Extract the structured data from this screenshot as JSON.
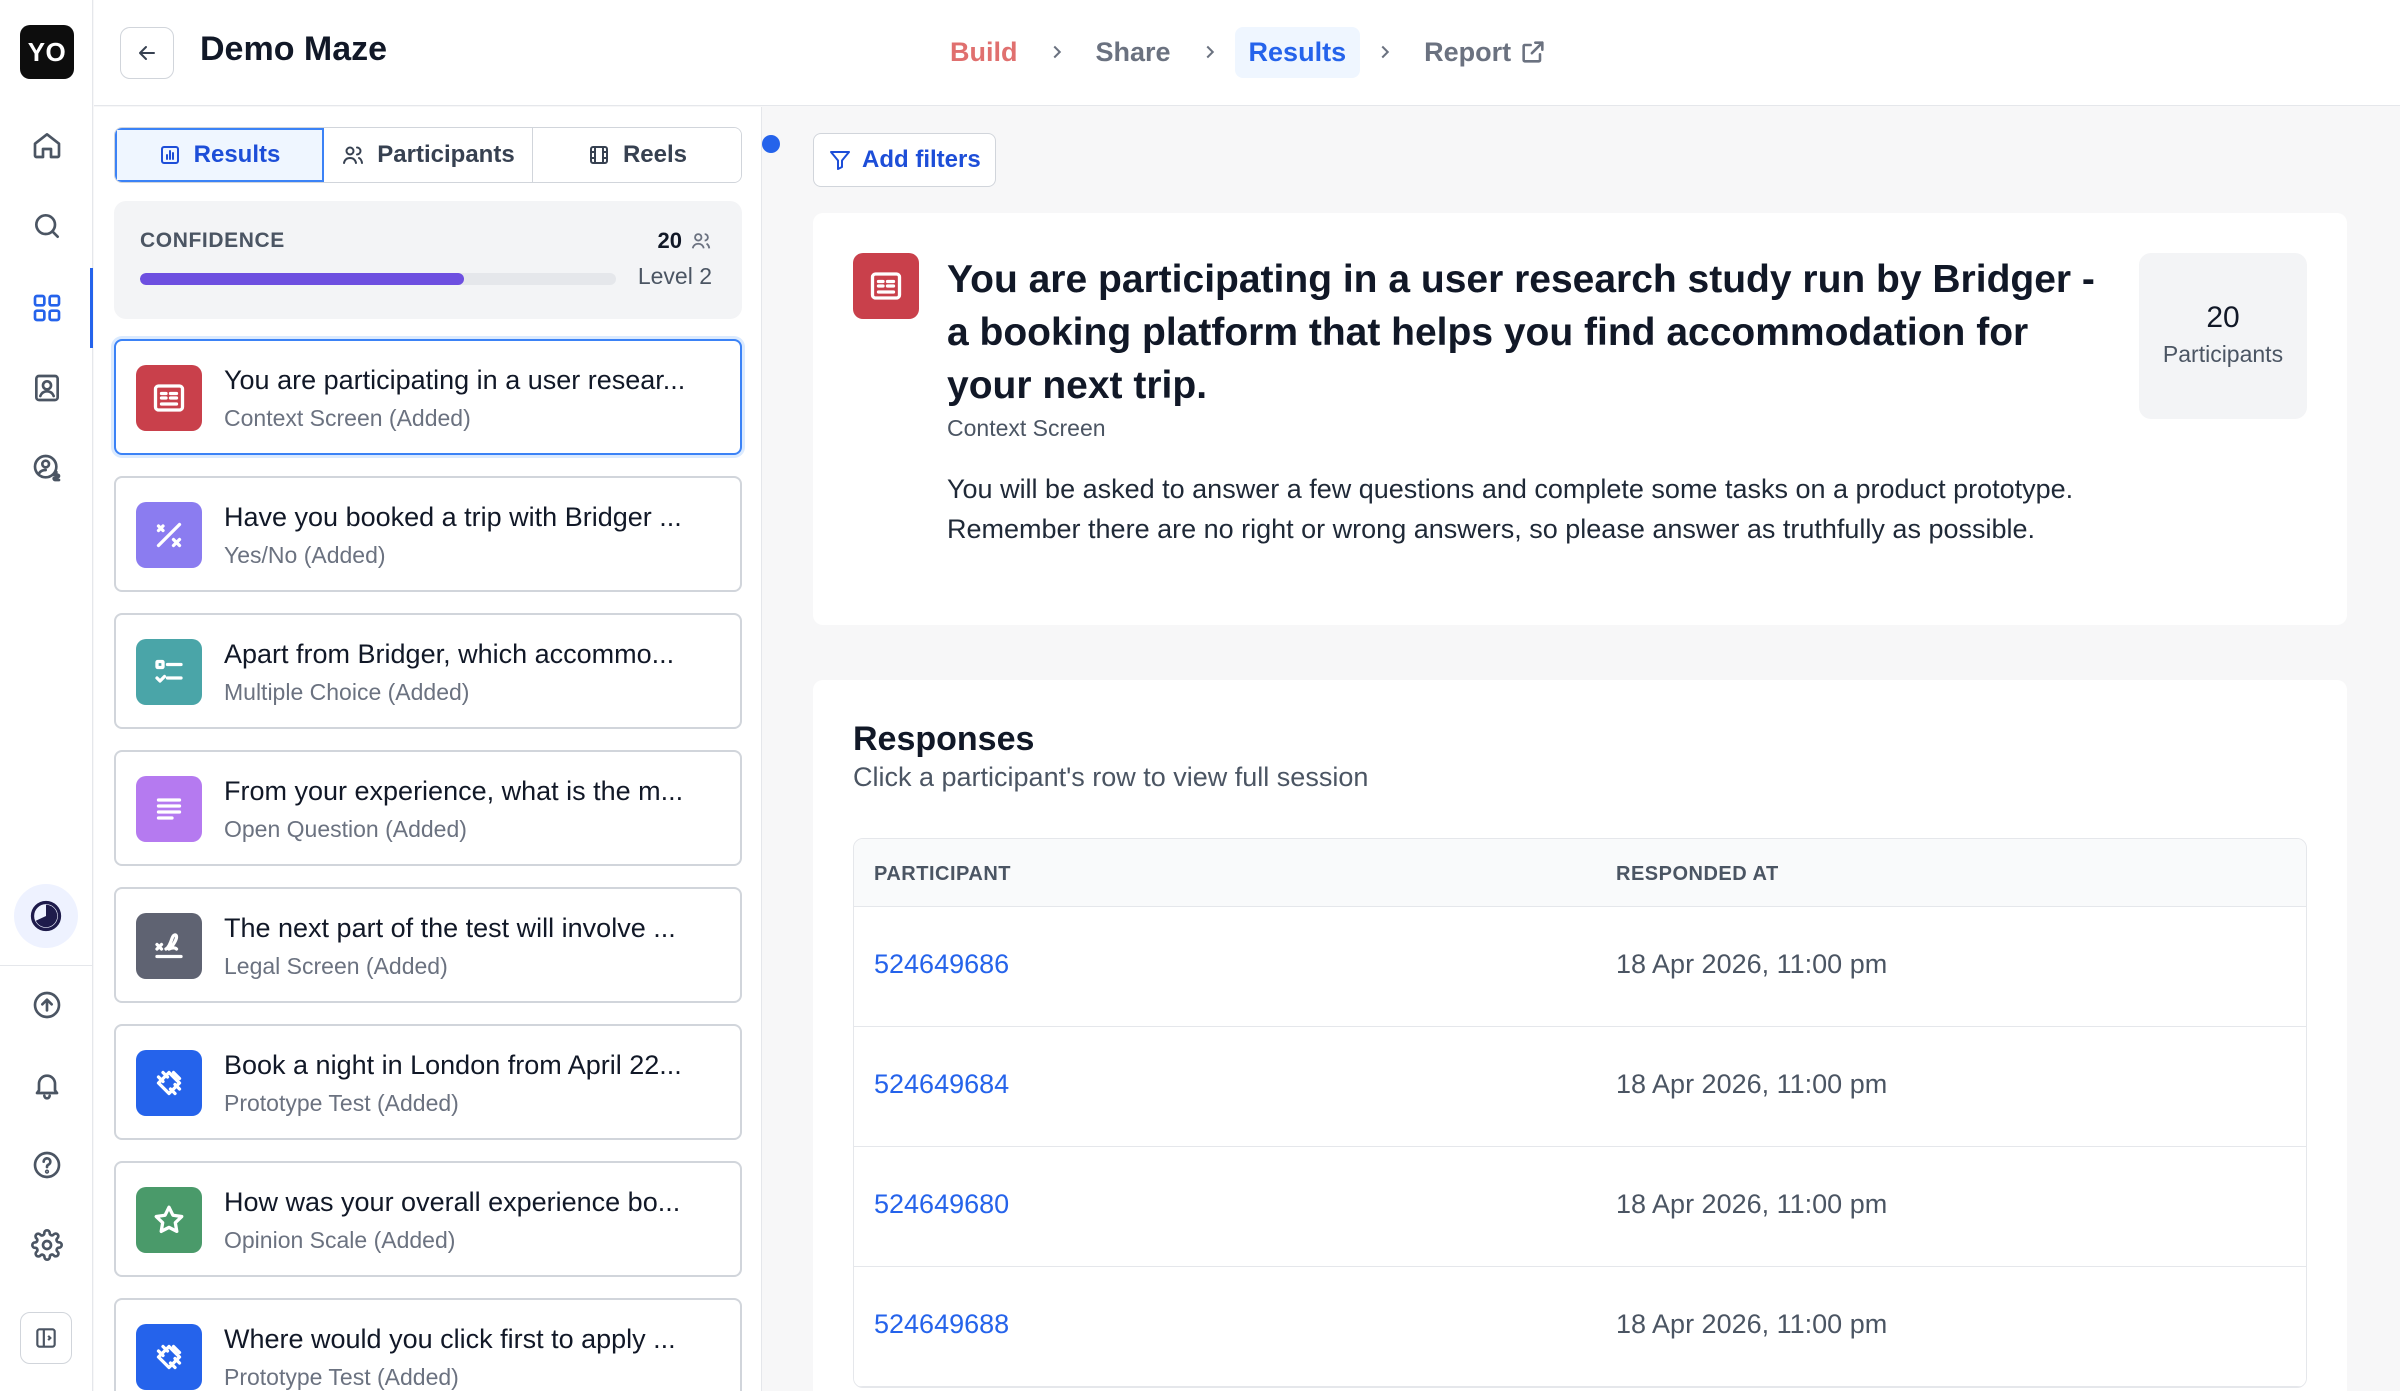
{
  "rail": {
    "logo": "YO",
    "items": [
      "home-icon",
      "search-icon",
      "grid-icon",
      "contacts-icon",
      "user-dollar-icon"
    ],
    "bottom_items": [
      "upload-icon",
      "bell-icon",
      "help-icon",
      "gear-icon"
    ]
  },
  "header": {
    "title": "Demo Maze",
    "steps": {
      "build": "Build",
      "share": "Share",
      "results": "Results",
      "report": "Report"
    }
  },
  "sidebar": {
    "tabs": {
      "results": "Results",
      "participants": "Participants",
      "reels": "Reels"
    },
    "confidence": {
      "label": "CONFIDENCE",
      "count": "20",
      "level": "Level 2",
      "progress": 0.68
    },
    "blocks": [
      {
        "title": "You are participating in a user resear...",
        "type": "Context Screen (Added)",
        "color": "#c9404b",
        "icon": "context-icon"
      },
      {
        "title": "Have you booked a trip with Bridger ...",
        "type": "Yes/No (Added)",
        "color": "#8b7cf0",
        "icon": "yes-no-icon"
      },
      {
        "title": "Apart from Bridger, which accommo...",
        "type": "Multiple Choice (Added)",
        "color": "#4aa5a8",
        "icon": "checklist-icon"
      },
      {
        "title": "From your experience, what is the m...",
        "type": "Open Question (Added)",
        "color": "#b57af0",
        "icon": "text-lines-icon"
      },
      {
        "title": "The next part of the test will involve ...",
        "type": "Legal Screen (Added)",
        "color": "#5f6372",
        "icon": "signature-icon"
      },
      {
        "title": "Book a night in London from April 22...",
        "type": "Prototype Test (Added)",
        "color": "#2563eb",
        "icon": "prototype-icon"
      },
      {
        "title": "How was your overall experience bo...",
        "type": "Opinion Scale (Added)",
        "color": "#4a9a6a",
        "icon": "star-icon"
      },
      {
        "title": "Where would you click first to apply ...",
        "type": "Prototype Test (Added)",
        "color": "#2563eb",
        "icon": "prototype-icon"
      }
    ]
  },
  "main": {
    "filters_label": "Add filters",
    "context": {
      "title": "You are participating in a user research study run by Bridger - a booking platform that helps you find accommodation for your next trip.",
      "type": "Context Screen",
      "description": "You will be asked to answer a few questions and complete some tasks on a product prototype. Remember there are no right or wrong answers, so please answer as truthfully as possible.",
      "participants_count": "20",
      "participants_label": "Participants"
    },
    "responses": {
      "title": "Responses",
      "subtitle": "Click a participant's row to view full session",
      "columns": [
        "PARTICIPANT",
        "RESPONDED AT"
      ],
      "rows": [
        {
          "id": "524649686",
          "time": "18 Apr 2026, 11:00 pm"
        },
        {
          "id": "524649684",
          "time": "18 Apr 2026, 11:00 pm"
        },
        {
          "id": "524649680",
          "time": "18 Apr 2026, 11:00 pm"
        },
        {
          "id": "524649688",
          "time": "18 Apr 2026, 11:00 pm"
        }
      ]
    }
  }
}
